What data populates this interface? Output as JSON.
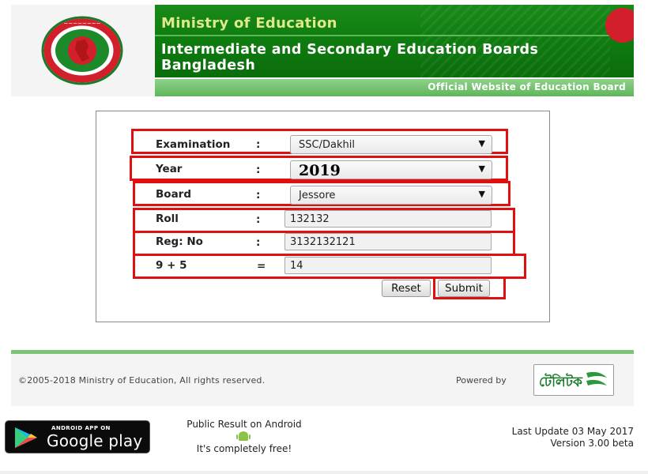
{
  "header": {
    "ministry_title": "Ministry of Education",
    "board_title": "Intermediate and Secondary Education Boards Bangladesh",
    "official_link": "Official Website of Education Board",
    "seal_icon": "government-seal-icon",
    "colors": {
      "banner_green": "#0f7d10",
      "subbar_green": "#6abd66",
      "flag_red": "#d21f2b"
    }
  },
  "form": {
    "rows": [
      {
        "label": "Examination",
        "sep": ":",
        "kind": "select",
        "value": "SSC/Dakhil"
      },
      {
        "label": "Year",
        "sep": ":",
        "kind": "select",
        "value": "2019"
      },
      {
        "label": "Board",
        "sep": ":",
        "kind": "select",
        "value": "Jessore"
      },
      {
        "label": "Roll",
        "sep": ":",
        "kind": "input",
        "value": "132132"
      },
      {
        "label": "Reg: No",
        "sep": ":",
        "kind": "input",
        "value": "3132132121"
      },
      {
        "label": "9 + 5",
        "sep": "=",
        "kind": "input",
        "value": "14"
      }
    ],
    "reset_label": "Reset",
    "submit_label": "Submit",
    "highlight_color": "#e01010"
  },
  "footer": {
    "copyright": "©2005-2018 Ministry of Education, All rights reserved.",
    "powered_by": "Powered by",
    "teletalk_logo": "টেলিটক"
  },
  "bottom": {
    "gplay_small": "ANDROID APP ON",
    "gplay_big": "Google play",
    "android_title": "Public Result on Android",
    "android_free": "It's completely free!",
    "last_update": "Last Update 03 May 2017",
    "version": "Version 3.00 beta"
  }
}
